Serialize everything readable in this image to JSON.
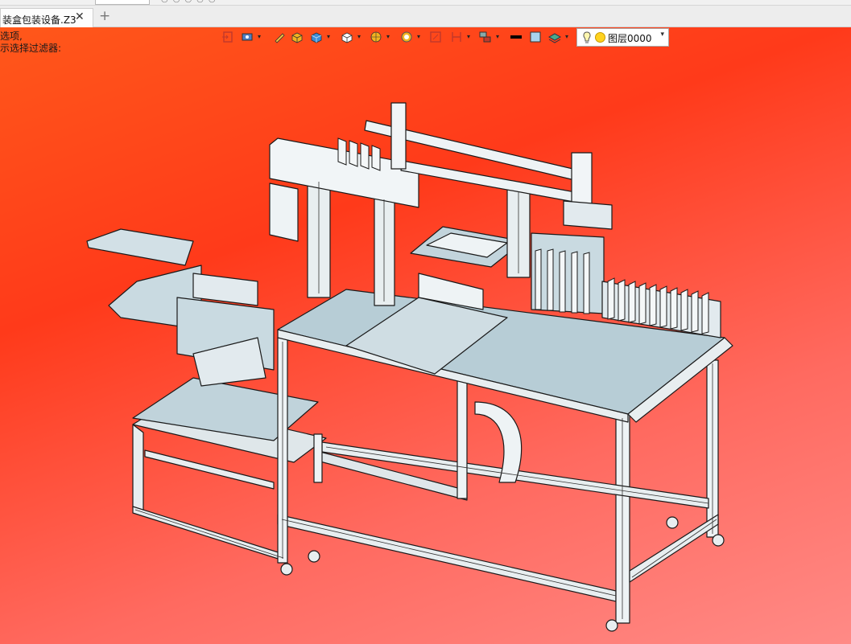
{
  "tab": {
    "title": "装盒包装设备.Z3",
    "close": "✕",
    "add": "+"
  },
  "prompt": {
    "line1": "选项,",
    "line2": "示选择过滤器:"
  },
  "toolbar": {
    "layer_label": "图层0000",
    "dropdown_symbol": "▾"
  },
  "colors": {
    "background_top": "#ff3a1a",
    "background_bottom": "#ff8a86",
    "model_fill": "#a8c3cf",
    "model_edge": "#1a1a1a",
    "model_light": "#e8eef0"
  }
}
